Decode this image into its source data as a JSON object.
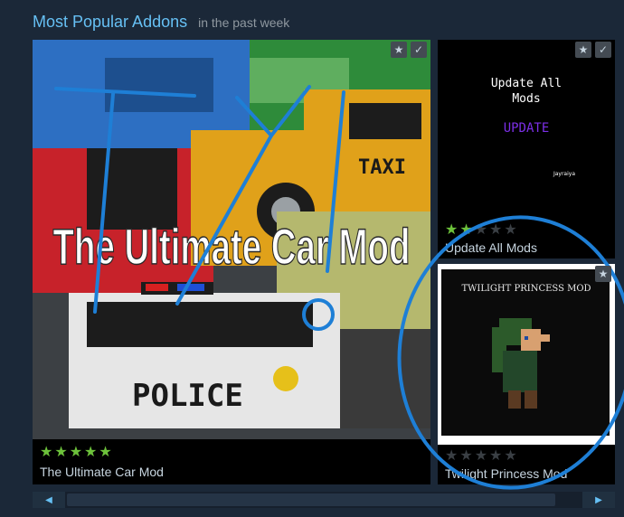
{
  "header": {
    "title": "Most Popular Addons",
    "subtitle": "in the past week"
  },
  "items": [
    {
      "name": "The Ultimate Car Mod",
      "image_text": "The Ultimate Car Mod",
      "image_taxi_text": "TAXI",
      "image_police_text": "POLICE",
      "rating": 5
    },
    {
      "name": "Update All Mods",
      "image_line1": "Update All",
      "image_line2": "Mods",
      "image_button": "UPDATE",
      "image_author": "Jayraiya",
      "rating": 2
    },
    {
      "name": "Twilight Princess Mod",
      "image_text": "TWILIGHT PRINCESS MOD",
      "rating": 0
    }
  ],
  "icons": {
    "favorite": "star-icon",
    "subscribed": "checkmark-icon",
    "scroll_left": "arrow-left-icon",
    "scroll_right": "arrow-right-icon"
  },
  "colors": {
    "background": "#1b2838",
    "title": "#66c0f4",
    "star_on": "#6dc23b",
    "annotation": "#1e7fd6"
  }
}
